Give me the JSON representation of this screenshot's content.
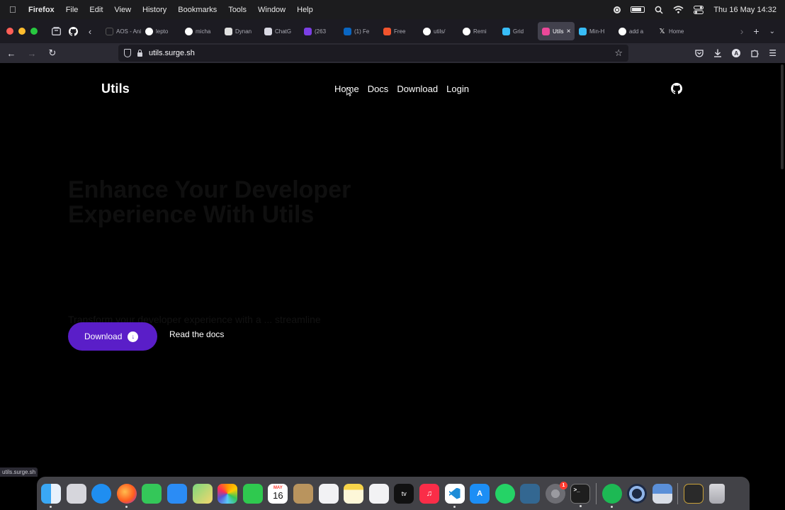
{
  "menubar": {
    "app": "Firefox",
    "items": [
      "File",
      "Edit",
      "View",
      "History",
      "Bookmarks",
      "Tools",
      "Window",
      "Help"
    ],
    "datetime": "Thu 16 May  14:32"
  },
  "tabs": [
    {
      "label": "AOS - Ani",
      "icon": "aos-icon",
      "color": "#1c1b22"
    },
    {
      "label": "lepto",
      "icon": "github-icon",
      "color": "#ffffff"
    },
    {
      "label": "micha",
      "icon": "github-icon",
      "color": "#ffffff"
    },
    {
      "label": "Dynan",
      "icon": "notion-icon",
      "color": "#e0e0e0"
    },
    {
      "label": "ChatG",
      "icon": "chatgpt-icon",
      "color": "#d9d9e3"
    },
    {
      "label": "(263",
      "icon": "mail-icon",
      "color": "#7b3fe4"
    },
    {
      "label": "(1) Fe",
      "icon": "linkedin-icon",
      "color": "#0a66c2"
    },
    {
      "label": "Free",
      "icon": "crown-icon",
      "color": "#f2542d"
    },
    {
      "label": "utils/",
      "icon": "github-icon",
      "color": "#ffffff"
    },
    {
      "label": "Remi",
      "icon": "github-icon",
      "color": "#ffffff"
    },
    {
      "label": "Grid",
      "icon": "tailwind-icon",
      "color": "#38bdf8"
    },
    {
      "label": "Utils",
      "icon": "utils-icon",
      "color": "#ec4899",
      "active": true
    },
    {
      "label": "Min-H",
      "icon": "tailwind-icon",
      "color": "#38bdf8"
    },
    {
      "label": "add a",
      "icon": "github-icon",
      "color": "#ffffff"
    },
    {
      "label": "Home",
      "icon": "x-icon",
      "color": "#ffffff"
    }
  ],
  "url": "utils.surge.sh",
  "site": {
    "brand": "Utils",
    "nav": [
      "Home",
      "Docs",
      "Download",
      "Login"
    ],
    "hero_title": "Enhance Your Developer Experience With Utils",
    "hero_subtitle": "Transform your developer experience with a ... streamline workflows and ...",
    "download_label": "Download",
    "docs_label": "Read the docs",
    "accent_color": "#5a1ec8"
  },
  "status_url": "utils.surge.sh",
  "dock": {
    "calendar_month": "MAY",
    "calendar_day": "16",
    "settings_badge": "1",
    "tv_label": "tv"
  }
}
